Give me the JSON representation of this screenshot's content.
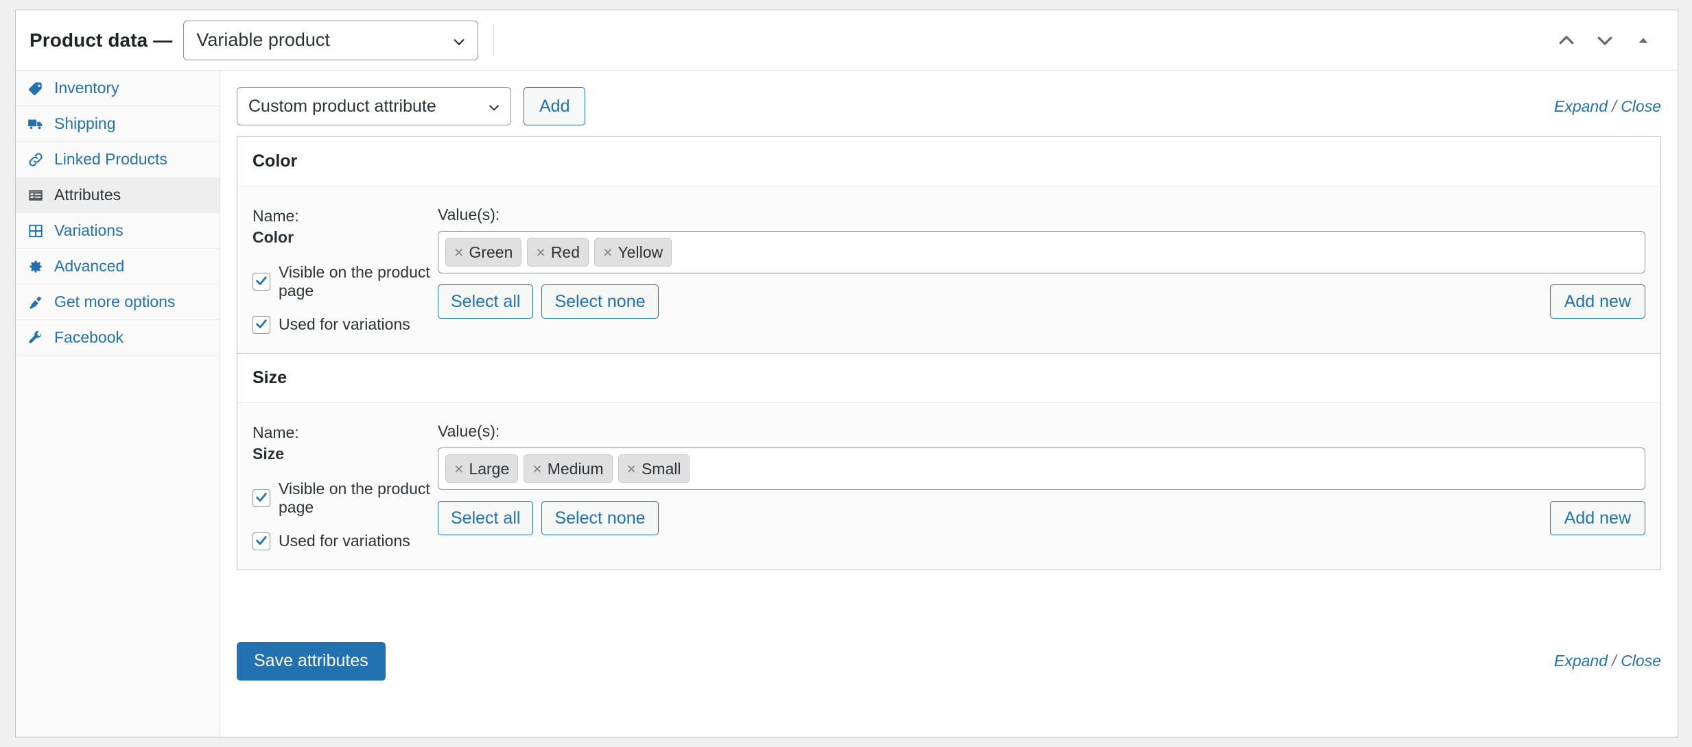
{
  "header": {
    "title": "Product data —",
    "product_type": "Variable product",
    "caret_icon": "chevron-down-icon",
    "actions": [
      {
        "name": "move-up-button",
        "icon": "chevron-up-icon"
      },
      {
        "name": "move-down-button",
        "icon": "chevron-down-icon"
      },
      {
        "name": "toggle-panel-button",
        "icon": "triangle-up-icon"
      }
    ]
  },
  "sidebar": {
    "items": [
      {
        "label": "Inventory",
        "icon": "tag-icon",
        "active": false
      },
      {
        "label": "Shipping",
        "icon": "truck-icon",
        "active": false
      },
      {
        "label": "Linked Products",
        "icon": "link-icon",
        "active": false
      },
      {
        "label": "Attributes",
        "icon": "list-view-icon",
        "active": true
      },
      {
        "label": "Variations",
        "icon": "grid-icon",
        "active": false
      },
      {
        "label": "Advanced",
        "icon": "gear-icon",
        "active": false
      },
      {
        "label": "Get more options",
        "icon": "plug-icon",
        "active": false
      },
      {
        "label": "Facebook",
        "icon": "wrench-icon",
        "active": false
      }
    ]
  },
  "toolbar": {
    "attribute_select_value": "Custom product attribute",
    "add_label": "Add",
    "expand_label": "Expand",
    "separator": "/",
    "close_label": "Close"
  },
  "attributes": [
    {
      "name": "Color",
      "name_label": "Name:",
      "values_label": "Value(s):",
      "visible_label": "Visible on the product page",
      "visible_checked": true,
      "variations_label": "Used for variations",
      "variations_checked": true,
      "values": [
        "Green",
        "Red",
        "Yellow"
      ],
      "select_all_label": "Select all",
      "select_none_label": "Select none",
      "add_new_label": "Add new"
    },
    {
      "name": "Size",
      "name_label": "Name:",
      "values_label": "Value(s):",
      "visible_label": "Visible on the product page",
      "visible_checked": true,
      "variations_label": "Used for variations",
      "variations_checked": true,
      "values": [
        "Large",
        "Medium",
        "Small"
      ],
      "select_all_label": "Select all",
      "select_none_label": "Select none",
      "add_new_label": "Add new"
    }
  ],
  "footer": {
    "save_label": "Save attributes",
    "expand_label": "Expand",
    "separator": "/",
    "close_label": "Close"
  },
  "colors": {
    "accent": "#2271b1",
    "active_tab_bg": "#eeeeee",
    "token_bg": "#e0e0e0",
    "border": "#c3c4c7"
  }
}
